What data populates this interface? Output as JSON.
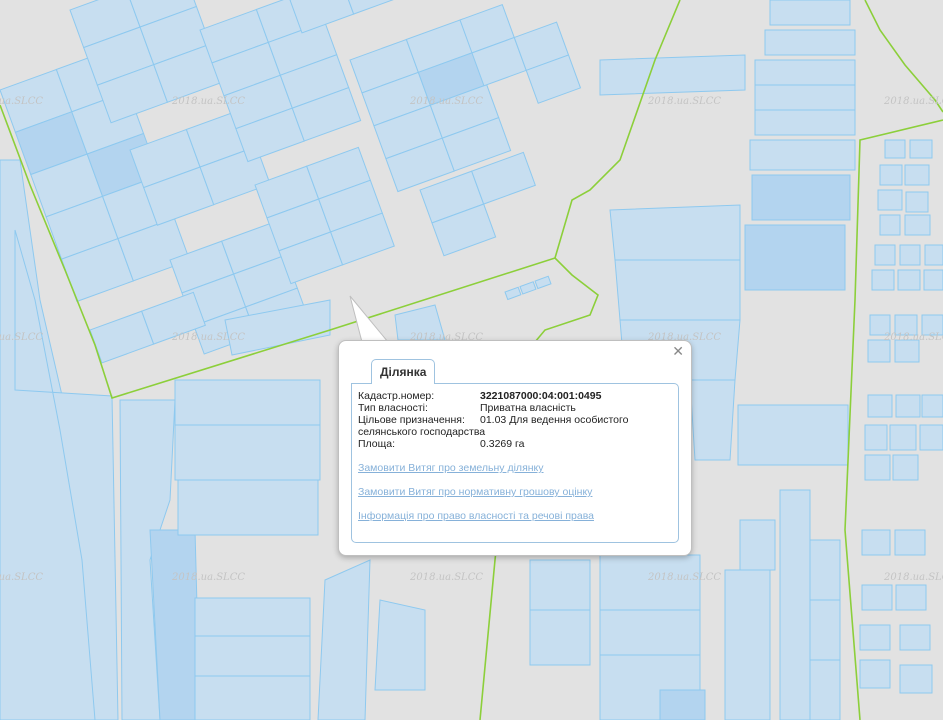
{
  "map": {
    "watermark": "2018.ua.SLCC",
    "colors": {
      "background": "#e2e2e2",
      "parcel_fill": "#c7def0",
      "parcel_fill_dark": "#b3d4ef",
      "parcel_stroke": "#8ec9ef",
      "boundary": "#8ccf3a"
    }
  },
  "popup": {
    "close_symbol": "✕",
    "tab_label": "Ділянка",
    "cadastre_label": "Кадастр.номер:",
    "cadastre_value": "3221087000:04:001:0495",
    "ownership_label": "Тип власності:",
    "ownership_value": "Приватна власність",
    "purpose_label": "Цільове призначення:",
    "purpose_value": "01.03 Для ведення особистого",
    "purpose_value_cont": "селянського господарства",
    "area_label": "Площа:",
    "area_value": "0.3269 га",
    "links": [
      "Замовити Витяг про земельну ділянку",
      "Замовити Витяг про нормативну грошову оцінку",
      "Інформація про право власності та речові права"
    ]
  }
}
